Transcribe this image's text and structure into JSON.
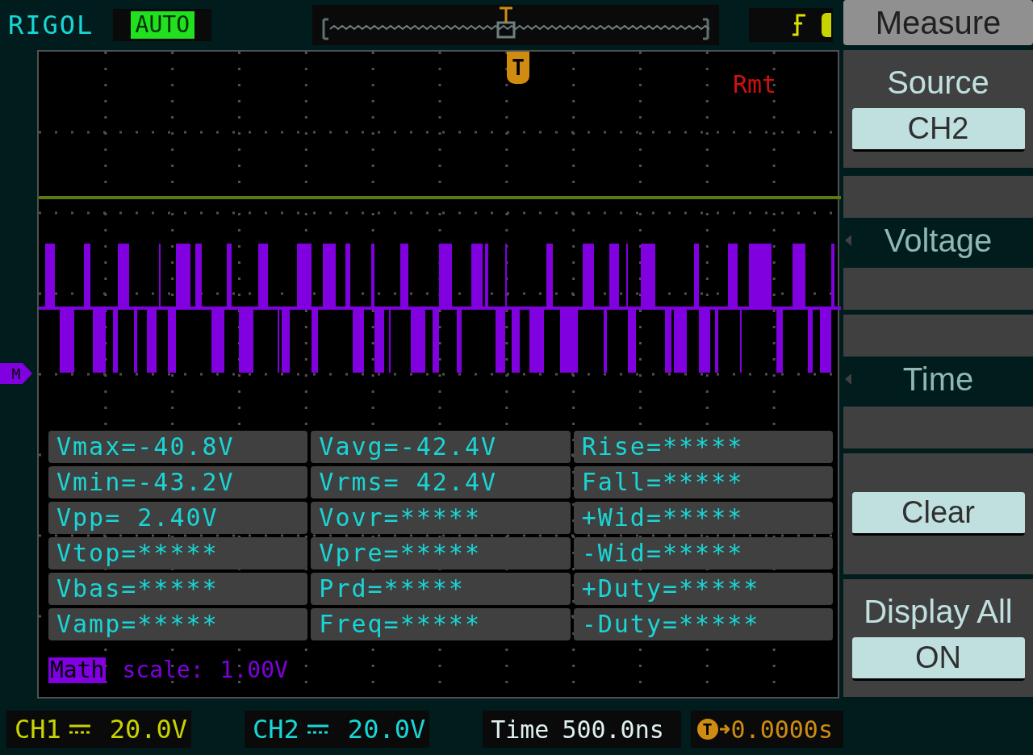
{
  "header": {
    "brand": "RIGOL",
    "mode": "AUTO"
  },
  "trigger_marker": "T",
  "remote": "Rmt",
  "math_marker": "M",
  "menu": {
    "title": "Measure",
    "items": [
      {
        "kind": "select",
        "label": "Source",
        "value": "CH2"
      },
      {
        "kind": "blank"
      },
      {
        "kind": "submenu",
        "label": "Voltage"
      },
      {
        "kind": "blank"
      },
      {
        "kind": "blank"
      },
      {
        "kind": "submenu",
        "label": "Time"
      },
      {
        "kind": "blank"
      },
      {
        "kind": "button",
        "label": "Clear"
      },
      {
        "kind": "select",
        "label": "Display All",
        "value": "ON"
      }
    ]
  },
  "measurements": [
    [
      "Vmax=-40.8V",
      "Vavg=-42.4V",
      "Rise=*****"
    ],
    [
      "Vmin=-43.2V",
      "Vrms= 42.4V",
      "Fall=*****"
    ],
    [
      "Vpp= 2.40V",
      "Vovr=*****",
      "+Wid=*****"
    ],
    [
      "Vtop=*****",
      "Vpre=*****",
      "-Wid=*****"
    ],
    [
      "Vbas=*****",
      "Prd=*****",
      "+Duty=*****"
    ],
    [
      "Vamp=*****",
      "Freq=*****",
      "-Duty=*****"
    ]
  ],
  "math": {
    "tag": "Math",
    "label": "scale:",
    "value": "1.00V"
  },
  "status": {
    "channels": [
      {
        "name": "CH1",
        "scale": "20.0V",
        "color": "#c8d400"
      },
      {
        "name": "CH2",
        "scale": "20.0V",
        "color": "#1ad5d5"
      }
    ],
    "time_label": "Time",
    "time_value": "500.0ns",
    "trigger_icon": "T",
    "trigger_offset": "0.0000s"
  }
}
